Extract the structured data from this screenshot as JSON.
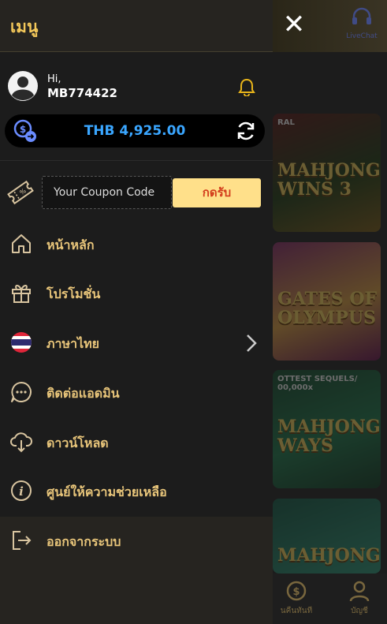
{
  "drawer": {
    "title": "เมนู",
    "user": {
      "greeting": "Hi,",
      "username": "MB774422"
    },
    "balance": {
      "amount": "THB 4,925.00"
    },
    "coupon": {
      "placeholder": "Your Coupon Code",
      "button_label": "กดรับ"
    },
    "menu": [
      {
        "label": "หน้าหลัก",
        "icon": "home-icon"
      },
      {
        "label": "โปรโมชั่น",
        "icon": "gift-icon"
      },
      {
        "label": "ภาษาไทย",
        "icon": "thai-flag-icon"
      },
      {
        "label": "ติดต่อแอดมิน",
        "icon": "chat-bubble-icon"
      },
      {
        "label": "ดาวน์โหลด",
        "icon": "cloud-download-icon"
      },
      {
        "label": "ศูนย์ให้ความช่วยเหลือ",
        "icon": "info-icon"
      },
      {
        "label": "ออกจากระบบ",
        "icon": "logout-icon"
      }
    ]
  },
  "background": {
    "livechat_label": "LiveChat",
    "games": [
      {
        "title": "MAHJONG WINS 3",
        "subtitle": "RAL"
      },
      {
        "title": "GATES OF OLYMPUS",
        "subtitle": ""
      },
      {
        "title": "MAHJONG WAYS",
        "subtitle": "OTTEST SEQUELS/ 00,000x"
      },
      {
        "title": "MAHJONG",
        "subtitle": ""
      }
    ],
    "bottom_nav": [
      {
        "label": "นคืนทันที"
      },
      {
        "label": "บัญชี"
      }
    ]
  },
  "colors": {
    "accent": "#e8c57a",
    "balance": "#3aa6ff",
    "coupon_button": "#ffe08a"
  }
}
